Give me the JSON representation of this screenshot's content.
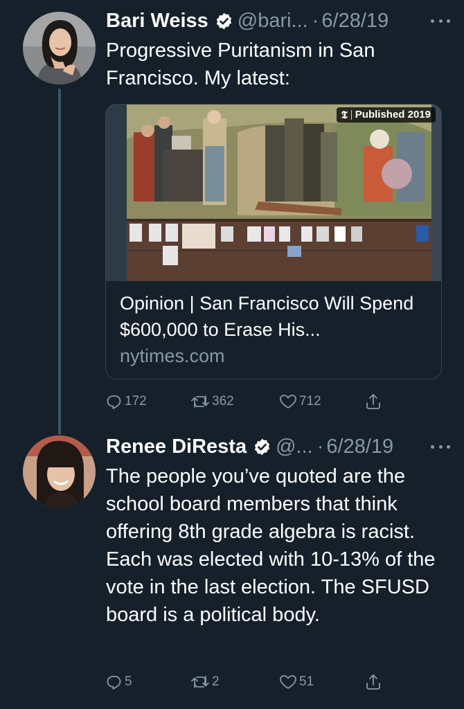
{
  "tweets": [
    {
      "name": "Bari Weiss",
      "handle": "@bari...",
      "separator": "·",
      "date": "6/28/19",
      "text": "Progressive Puritanism in San Francisco. My latest:",
      "card": {
        "badge": "Published 2019",
        "badge_logo": "𝕿",
        "title": "Opinion | San Francisco Will Spend $600,000 to Erase His...",
        "domain": "nytimes.com"
      },
      "replies": "172",
      "retweets": "362",
      "likes": "712"
    },
    {
      "name": "Renee DiResta",
      "handle": "@...",
      "separator": "·",
      "date": "6/28/19",
      "text": "The people you’ve quoted are the school board members that think offering 8th grade algebra is racist. Each was elected with 10-13% of the vote in the last election. The SFUSD board is a political body.",
      "replies": "5",
      "retweets": "2",
      "likes": "51"
    }
  ],
  "icons": {
    "verified": "verified-badge-icon",
    "more": "more-dots-icon",
    "reply": "reply-icon",
    "retweet": "retweet-icon",
    "like": "heart-icon",
    "share": "share-icon"
  },
  "colors": {
    "background": "#15202b",
    "text_primary": "#ffffff",
    "text_secondary": "#8899a6",
    "border": "#38444d",
    "thread_line": "#3d5466"
  }
}
